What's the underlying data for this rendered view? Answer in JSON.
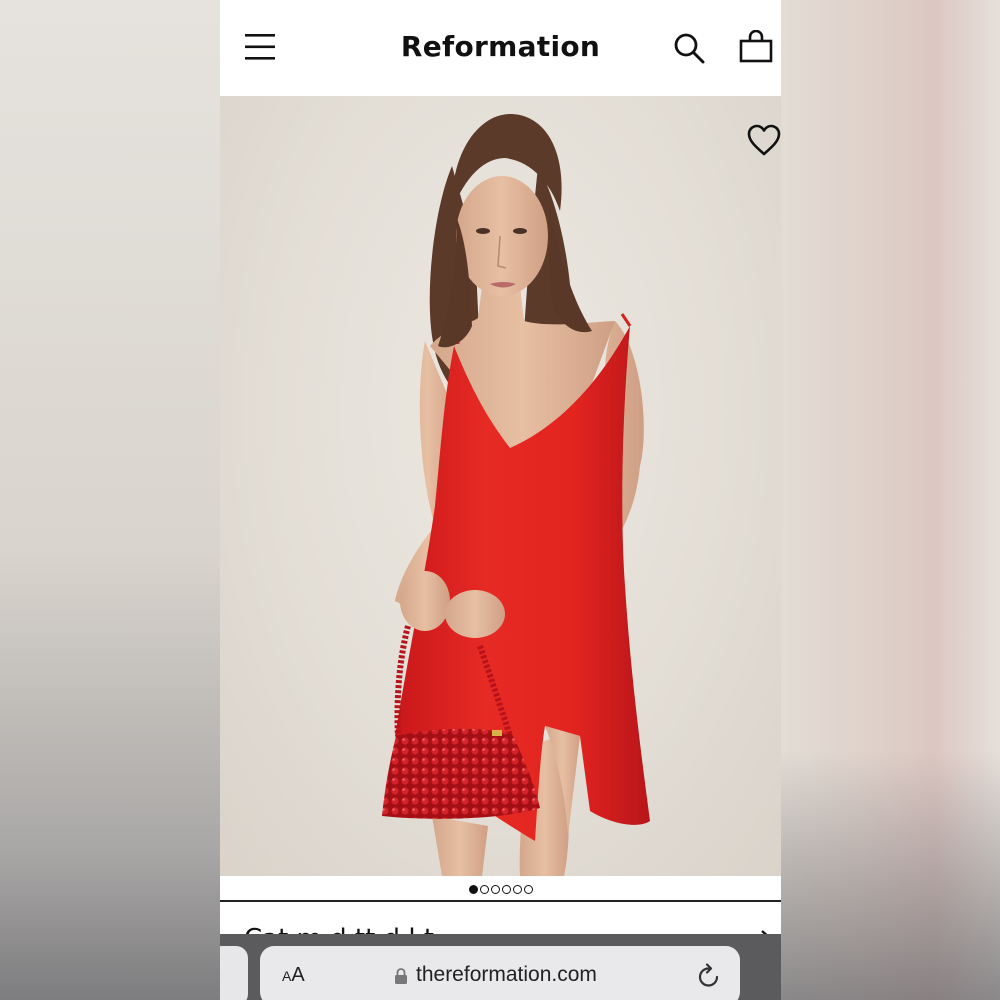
{
  "header": {
    "brand": "Reformation",
    "menu_icon": "hamburger-menu-icon",
    "search_icon": "search-icon",
    "bag_icon": "shopping-bag-icon"
  },
  "product": {
    "image_alt": "Model wearing red slip mini dress holding beaded red handbag",
    "favorite_icon": "heart-icon",
    "carousel": {
      "total": 6,
      "active_index": 0
    },
    "title_partial": "Cat  m   d  tt    d  l  t",
    "next_icon": "chevron-right-icon"
  },
  "browser": {
    "aa_small": "A",
    "aa_large": "A",
    "url": "thereformation.com",
    "lock_icon": "lock-icon",
    "reload_icon": "reload-icon"
  },
  "colors": {
    "dress_red": "#e2231f",
    "bag_red": "#c01418",
    "backdrop": "#e6e1d9",
    "safari_bar": "#5b5b5e"
  }
}
